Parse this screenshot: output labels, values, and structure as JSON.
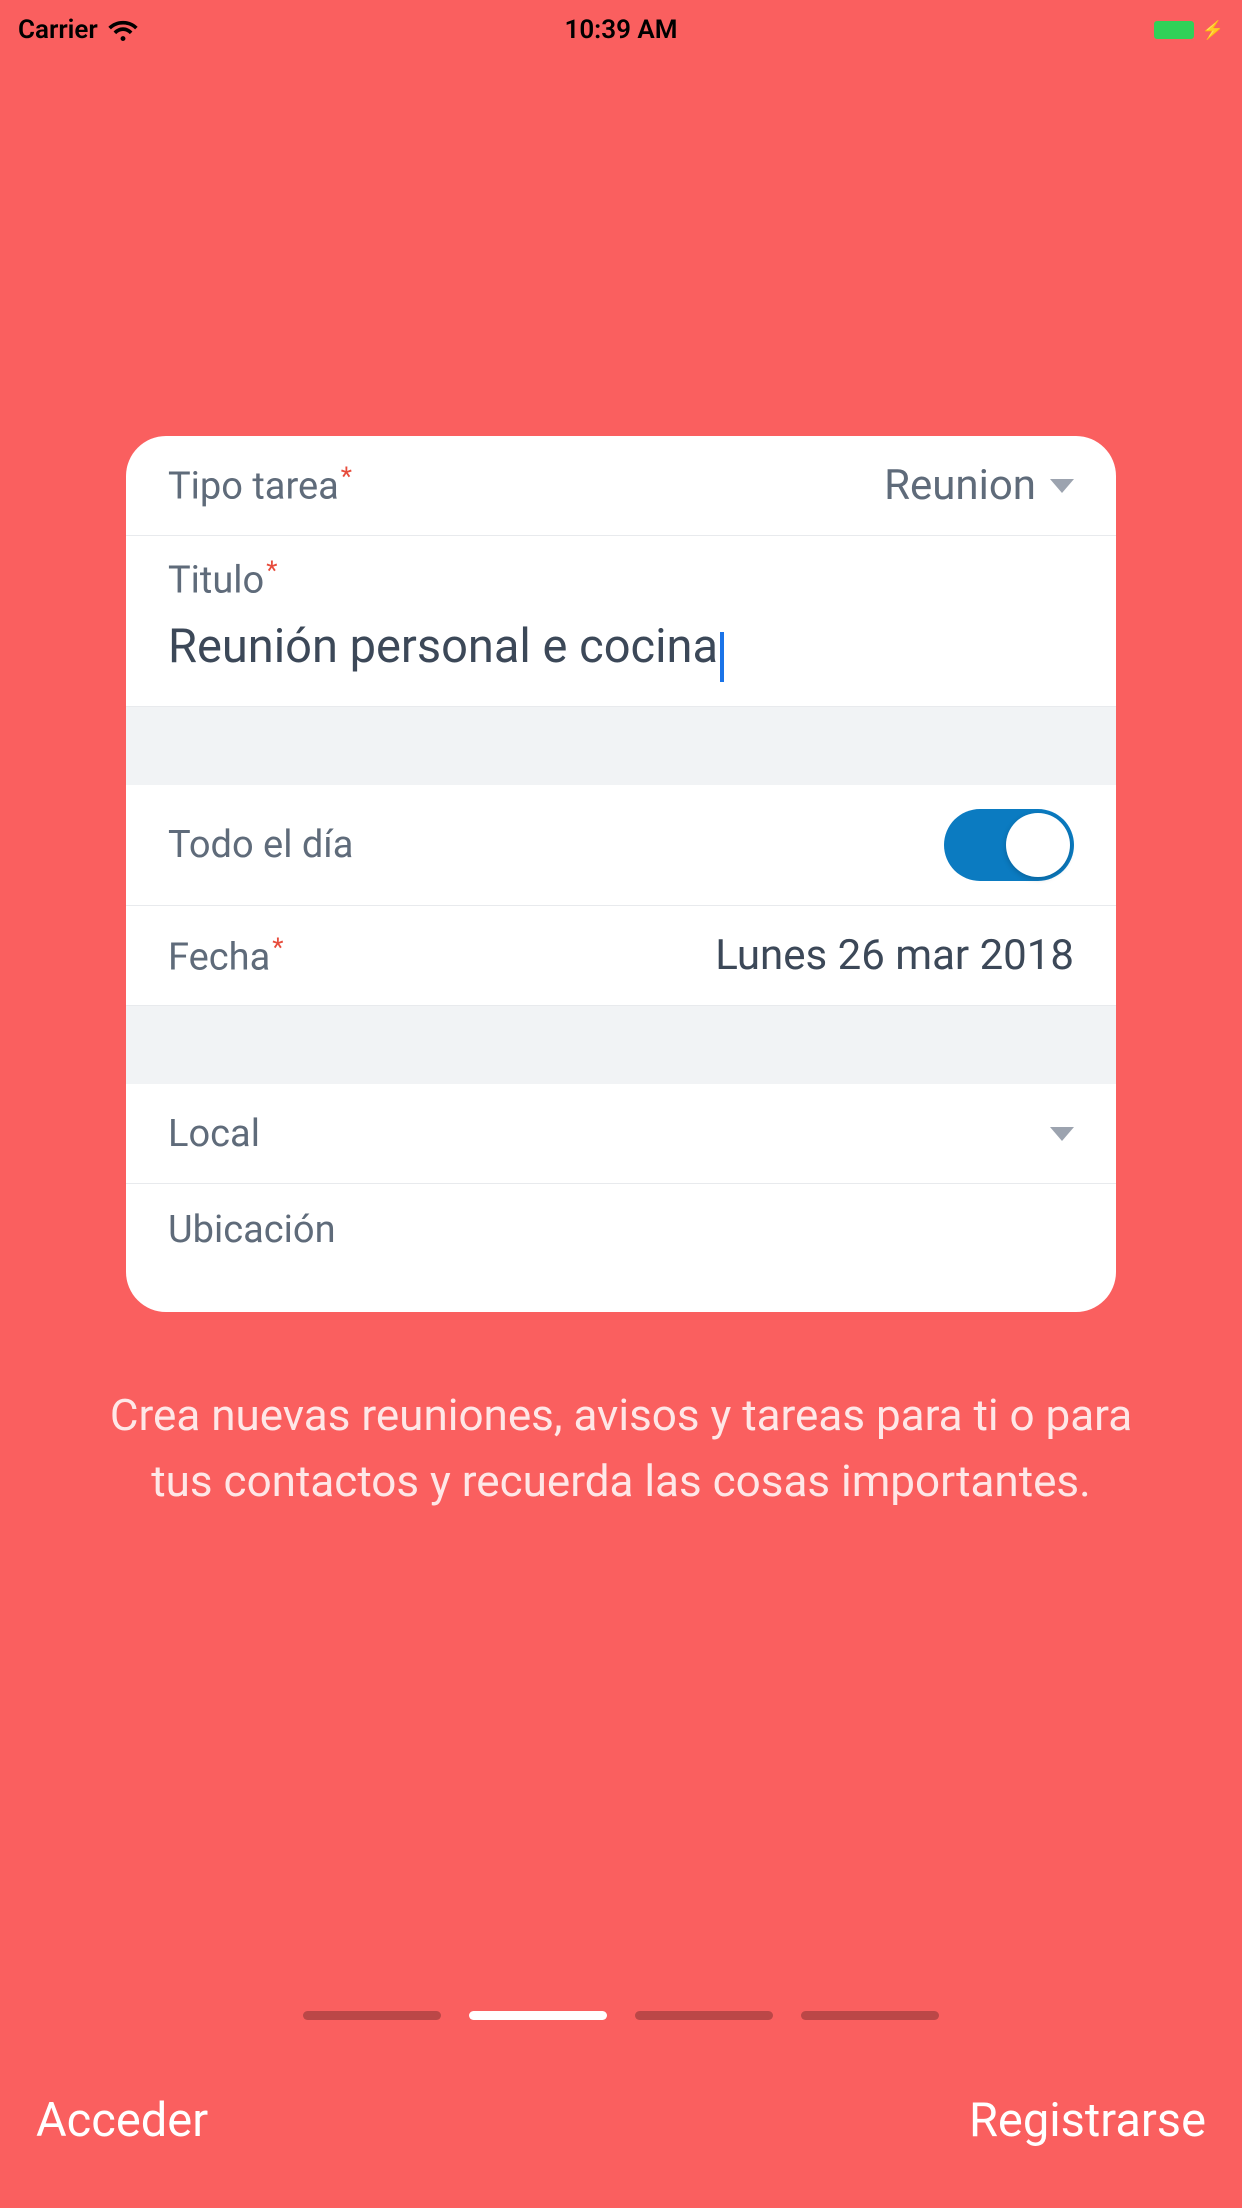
{
  "statusBar": {
    "carrier": "Carrier",
    "time": "10:39 AM"
  },
  "card": {
    "taskType": {
      "label": "Tipo tarea",
      "value": "Reunion"
    },
    "title": {
      "label": "Titulo",
      "value": "Reunión personal e cocina"
    },
    "allDay": {
      "label": "Todo el día",
      "enabled": true
    },
    "date": {
      "label": "Fecha",
      "value": "Lunes 26 mar 2018"
    },
    "local": {
      "label": "Local"
    },
    "location": {
      "label": "Ubicación"
    }
  },
  "description": "Crea nuevas reuniones, avisos y tareas para ti o para tus contactos y recuerda las cosas importantes.",
  "pagination": {
    "total": 4,
    "current": 1
  },
  "buttons": {
    "login": "Acceder",
    "register": "Registrarse"
  }
}
